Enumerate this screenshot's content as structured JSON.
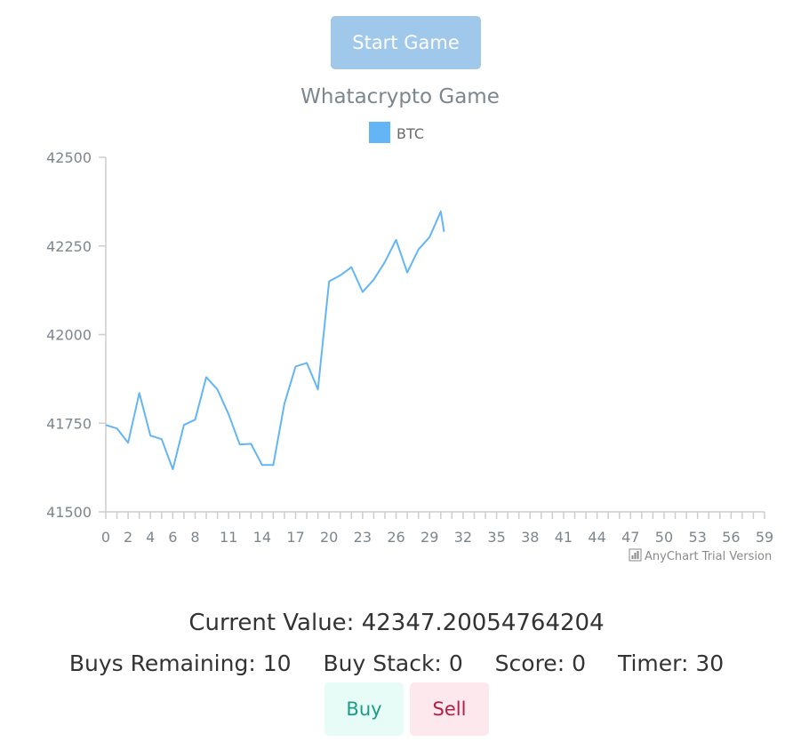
{
  "controls": {
    "start_label": "Start Game",
    "buy_label": "Buy",
    "sell_label": "Sell"
  },
  "stats": {
    "current_value_label": "Current Value:",
    "current_value": "42347.20054764204",
    "buys_remaining_label": "Buys Remaining:",
    "buys_remaining": "10",
    "buy_stack_label": "Buy Stack:",
    "buy_stack": "0",
    "score_label": "Score:",
    "score": "0",
    "timer_label": "Timer:",
    "timer": "30"
  },
  "watermark": "AnyChart Trial Version",
  "colors": {
    "series": "#64b5f6",
    "start_button": "#a0c8ea",
    "buy_bg": "#e8fcf7",
    "buy_text": "#1a9c86",
    "sell_bg": "#fde8ee",
    "sell_text": "#b02047"
  },
  "chart_data": {
    "type": "line",
    "title": "Whatacrypto Game",
    "legend_position": "top-center",
    "series": [
      {
        "name": "BTC",
        "values": [
          41745,
          41735,
          41695,
          41835,
          41715,
          41705,
          41620,
          41745,
          41760,
          41880,
          41845,
          41775,
          41690,
          41692,
          41632,
          41632,
          41805,
          41910,
          41920,
          41845,
          42150,
          42167,
          42190,
          42120,
          42155,
          42205,
          42267,
          42175,
          42240,
          42275,
          42347,
          42290
        ]
      }
    ],
    "x": [
      0,
      1,
      2,
      3,
      4,
      5,
      6,
      7,
      8,
      9,
      10,
      11,
      12,
      13,
      14,
      15,
      16,
      17,
      18,
      19,
      20,
      21,
      22,
      23,
      24,
      25,
      26,
      27,
      28,
      29,
      30,
      30.3
    ],
    "xlim": [
      0,
      59
    ],
    "x_tick_labels": [
      "0",
      "2",
      "4",
      "6",
      "8",
      "11",
      "14",
      "17",
      "20",
      "23",
      "26",
      "29",
      "32",
      "35",
      "38",
      "41",
      "44",
      "47",
      "50",
      "53",
      "56",
      "59"
    ],
    "ylim": [
      41500,
      42500
    ],
    "y_ticks": [
      41500,
      41750,
      42000,
      42250,
      42500
    ],
    "grid": false
  }
}
